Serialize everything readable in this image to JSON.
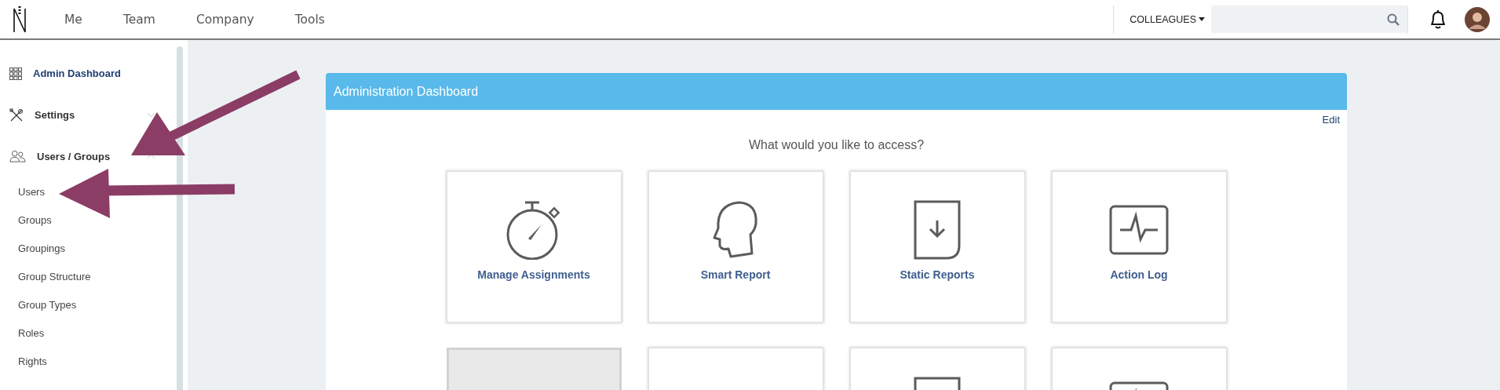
{
  "topbar": {
    "nav": [
      {
        "label": "Me"
      },
      {
        "label": "Team"
      },
      {
        "label": "Company"
      },
      {
        "label": "Tools"
      }
    ],
    "people_menu": "COLLEAGUES"
  },
  "sidebar": {
    "items": [
      {
        "label": "Admin Dashboard",
        "kind": "link",
        "selected": true
      },
      {
        "label": "Settings",
        "kind": "group",
        "selected": false,
        "expanded": false
      },
      {
        "label": "Users / Groups",
        "kind": "group",
        "selected": false,
        "expanded": true,
        "children": [
          {
            "label": "Users"
          },
          {
            "label": "Groups"
          },
          {
            "label": "Groupings"
          },
          {
            "label": "Group Structure"
          },
          {
            "label": "Group Types"
          },
          {
            "label": "Roles"
          },
          {
            "label": "Rights"
          }
        ]
      }
    ]
  },
  "panel": {
    "title": "Administration Dashboard",
    "edit": "Edit",
    "question": "What would you like to access?",
    "tiles": [
      {
        "label": "Manage Assignments",
        "kind": "stopwatch",
        "highlighted": false
      },
      {
        "label": "Smart Report",
        "kind": "head",
        "highlighted": false
      },
      {
        "label": "Static Reports",
        "kind": "document",
        "highlighted": false
      },
      {
        "label": "Action Log",
        "kind": "monitor",
        "highlighted": false
      },
      {
        "kind": "blank",
        "highlighted": true
      },
      {
        "kind": "blank",
        "highlighted": false
      },
      {
        "kind": "document",
        "highlighted": false
      },
      {
        "kind": "monitor",
        "highlighted": false
      }
    ]
  }
}
